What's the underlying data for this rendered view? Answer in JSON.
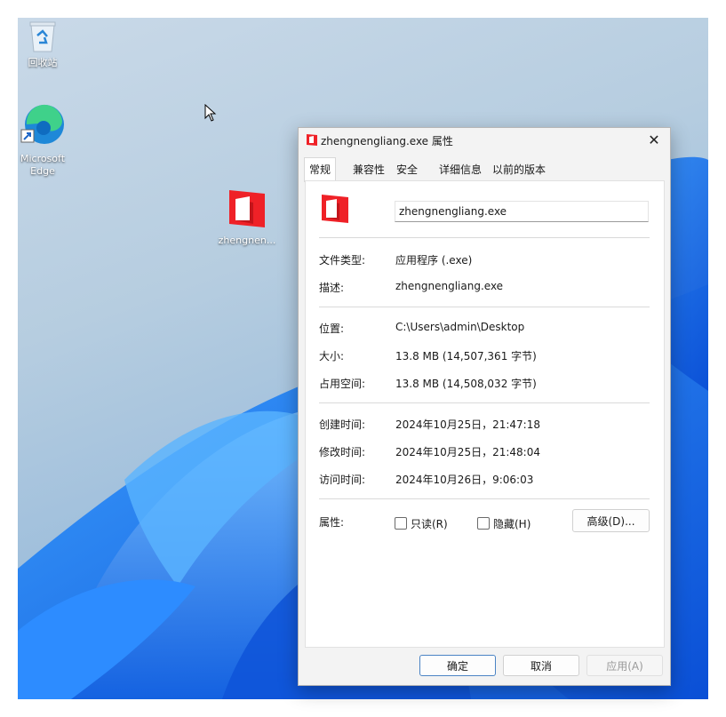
{
  "desktop": {
    "icons": [
      {
        "label": "回收站",
        "icon": "recycle-bin-icon"
      },
      {
        "label_line1": "Microsoft",
        "label_line2": "Edge",
        "icon": "edge-icon"
      },
      {
        "label": "zhengnen...",
        "icon": "app-icon"
      }
    ]
  },
  "dialog": {
    "title": "zhengnengliang.exe 属性",
    "tabs": [
      "常规",
      "兼容性",
      "安全",
      "详细信息",
      "以前的版本"
    ],
    "active_tab": "常规",
    "file_name": "zhengnengliang.exe",
    "fields": {
      "type_label": "文件类型:",
      "type_value": "应用程序 (.exe)",
      "desc_label": "描述:",
      "desc_value": "zhengnengliang.exe",
      "location_label": "位置:",
      "location_value": "C:\\Users\\admin\\Desktop",
      "size_label": "大小:",
      "size_value": "13.8 MB (14,507,361 字节)",
      "disk_label": "占用空间:",
      "disk_value": "13.8 MB (14,508,032 字节)",
      "created_label": "创建时间:",
      "created_value": "2024年10月25日，21:47:18",
      "modified_label": "修改时间:",
      "modified_value": "2024年10月25日，21:48:04",
      "accessed_label": "访问时间:",
      "accessed_value": "2024年10月26日，9:06:03",
      "attr_label": "属性:"
    },
    "attributes": {
      "readonly": "只读(R)",
      "hidden": "隐藏(H)",
      "advanced": "高级(D)..."
    },
    "buttons": {
      "ok": "确定",
      "cancel": "取消",
      "apply": "应用(A)"
    },
    "close_symbol": "✕"
  },
  "colors": {
    "accent": "#e81f25",
    "primary_border": "#4b84c4"
  }
}
